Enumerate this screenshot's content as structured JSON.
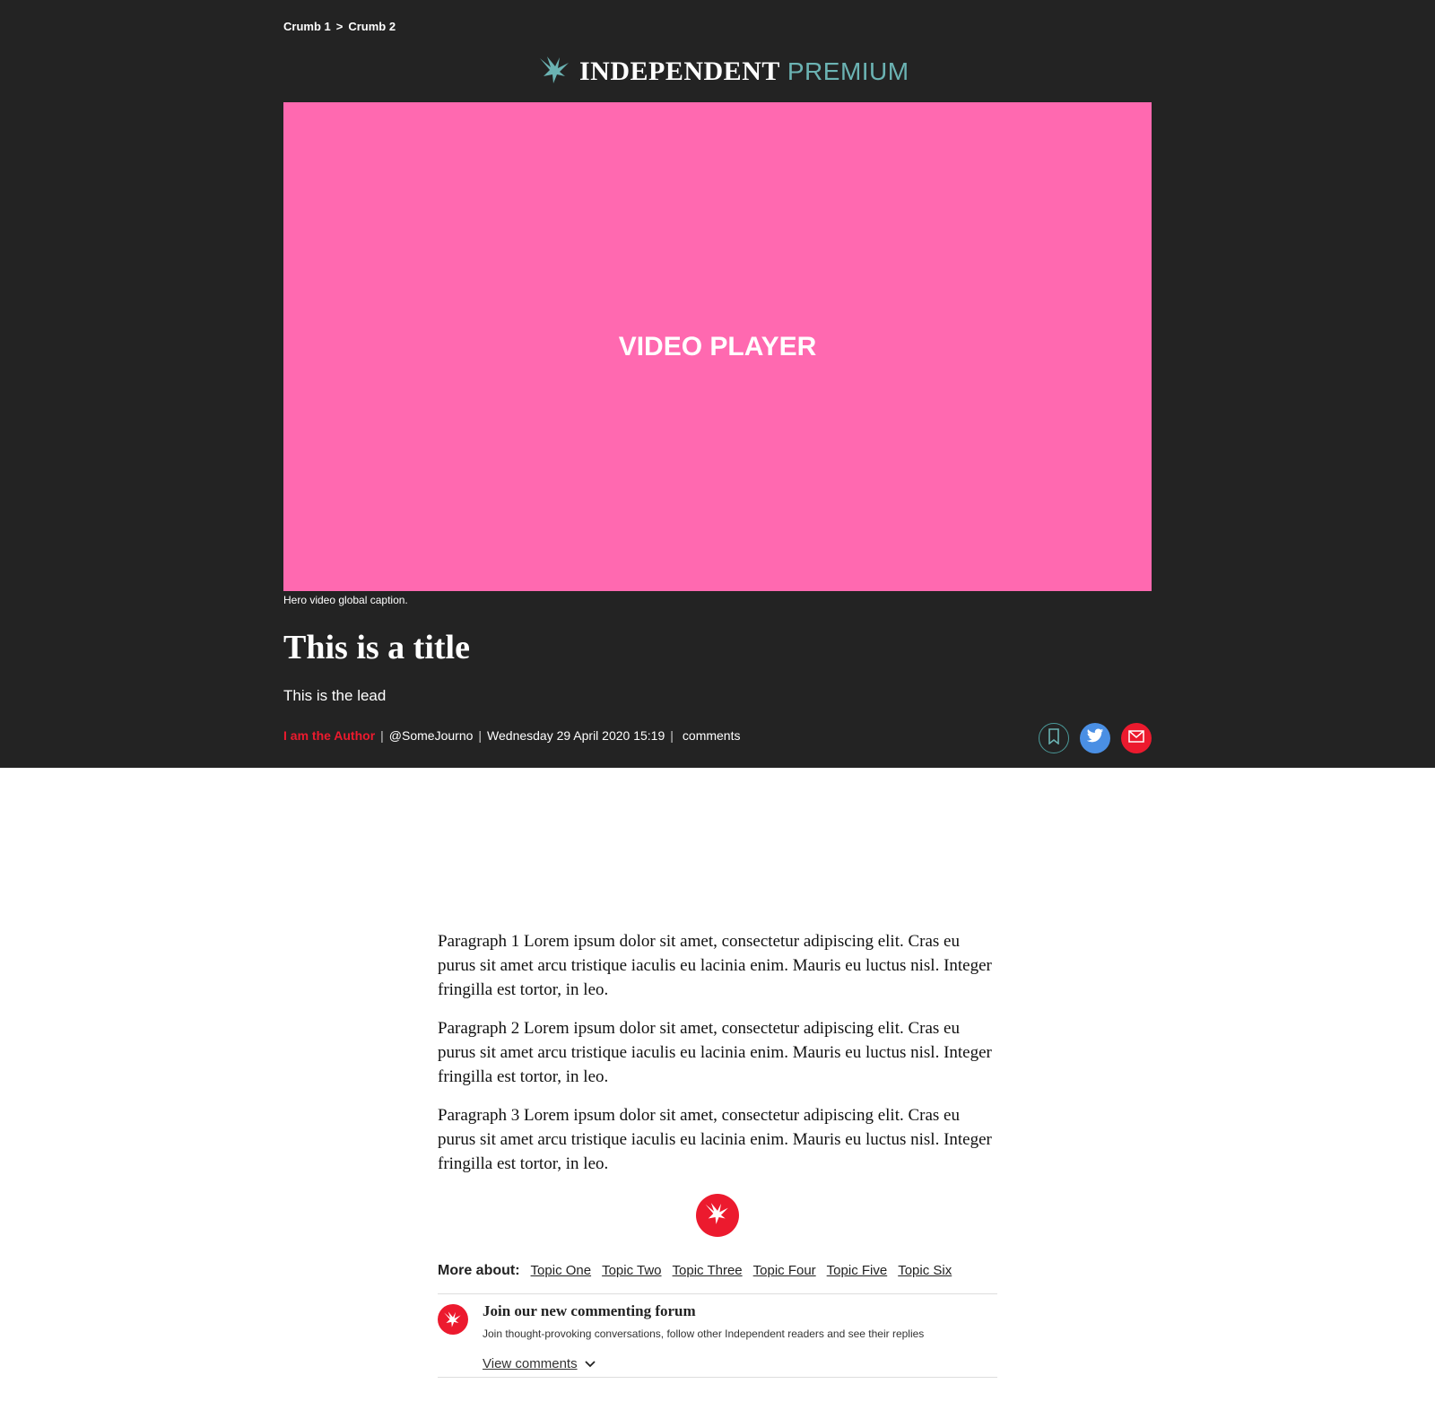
{
  "breadcrumb": {
    "crumb1": "Crumb 1",
    "separator": ">",
    "crumb2": "Crumb 2"
  },
  "logo": {
    "main": "INDEPENDENT",
    "premium": "PREMIUM",
    "icon": "eagle-icon"
  },
  "video": {
    "label": "VIDEO PLAYER",
    "color": "#ff69b0"
  },
  "caption": "Hero video global caption.",
  "article": {
    "title": "This is a title",
    "lead": "This is the lead",
    "author": "I am the Author",
    "handle": "@SomeJourno",
    "date": "Wednesday 29 April 2020 15:19",
    "comments_label": "comments",
    "paragraphs": [
      "Paragraph 1 Lorem ipsum dolor sit amet, consectetur adipiscing elit. Cras eu purus sit amet arcu tristique iaculis eu lacinia enim. Mauris eu luctus nisl. Integer fringilla est tortor, in leo.",
      "Paragraph 2 Lorem ipsum dolor sit amet, consectetur adipiscing elit. Cras eu purus sit amet arcu tristique iaculis eu lacinia enim. Mauris eu luctus nisl. Integer fringilla est tortor, in leo.",
      "Paragraph 3 Lorem ipsum dolor sit amet, consectetur adipiscing elit. Cras eu purus sit amet arcu tristique iaculis eu lacinia enim. Mauris eu luctus nisl. Integer fringilla est tortor, in leo."
    ]
  },
  "share": {
    "icons": [
      "bookmark-icon",
      "twitter-icon",
      "email-icon"
    ]
  },
  "topics": {
    "label": "More about:",
    "items": [
      "Topic One",
      "Topic Two",
      "Topic Three",
      "Topic Four",
      "Topic Five",
      "Topic Six"
    ]
  },
  "comments": {
    "title": "Join our new commenting forum",
    "subtitle": "Join thought-provoking conversations, follow other Independent readers and see their replies",
    "view_label": "View comments"
  },
  "colors": {
    "hero_bg": "#232323",
    "brand_red": "#ec1a2e",
    "premium_teal": "#6bb3b3",
    "twitter_blue": "#4a8fe4"
  }
}
